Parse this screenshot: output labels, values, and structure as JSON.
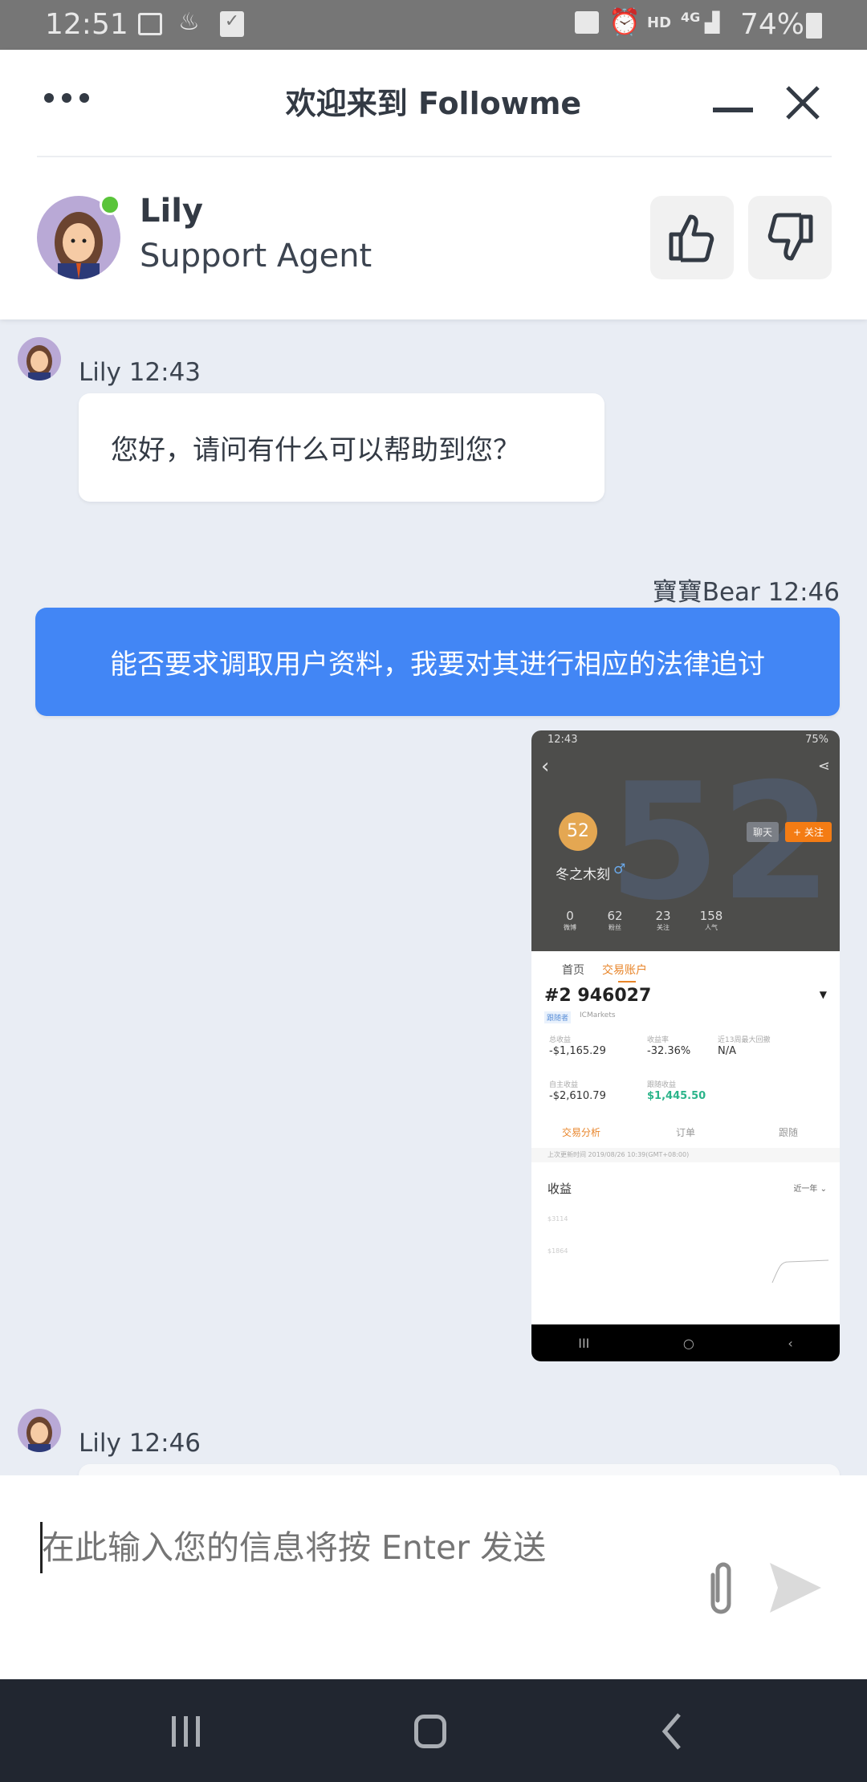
{
  "status_bar": {
    "time": "12:51",
    "battery": "74%",
    "network": "4G",
    "hd": "HD"
  },
  "header": {
    "title": "欢迎来到 Followme",
    "menu_icon": "more-dots-icon",
    "minimize_icon": "minimize-icon",
    "close_icon": "close-icon"
  },
  "agent": {
    "name": "Lily",
    "role": "Support Agent",
    "online": true,
    "online_color": "#5ac43a",
    "thumbs_up_icon": "thumbs-up-icon",
    "thumbs_down_icon": "thumbs-down-icon"
  },
  "messages": [
    {
      "sender": "Lily",
      "time": "Lily 12:43",
      "text": "您好，请问有什么可以帮助到您？"
    },
    {
      "sender": "寶寶Bear",
      "time": "寶寶Bear 12:46",
      "text": "能否要求调取用户资料，我要对其进行相应的法律追讨",
      "color": "#4286f5"
    },
    {
      "sender": "寶寶Bear",
      "type": "image"
    },
    {
      "sender": "Lily",
      "time": "Lily 12:46",
      "text": ""
    }
  ],
  "shared_image": {
    "status_time": "12:43",
    "status_battery": "75%",
    "level": "52",
    "username": "冬之木刻",
    "gender": "♂",
    "chat_btn": "聊天",
    "follow_btn": "+ 关注",
    "stats": [
      {
        "v": "0",
        "l": "微博"
      },
      {
        "v": "62",
        "l": "粉丝"
      },
      {
        "v": "23",
        "l": "关注"
      },
      {
        "v": "158",
        "l": "人气"
      }
    ],
    "tabs": [
      "首页",
      "交易账户"
    ],
    "account": "#2 946027",
    "tag1": "跟随者",
    "tag2": "ICMarkets",
    "metrics": [
      {
        "l": "总收益",
        "v": "-$1,165.29"
      },
      {
        "l": "收益率",
        "v": "-32.36%"
      },
      {
        "l": "近13周最大回撤",
        "v": "N/A"
      },
      {
        "l": "自主收益",
        "v": "-$2,610.79"
      },
      {
        "l": "跟随收益",
        "v": "$1,445.50"
      }
    ],
    "subtabs": [
      "交易分析",
      "订单",
      "跟随"
    ],
    "updated": "上次更新时间 2019/08/26 10:39(GMT+08:00)",
    "chart_title": "收益",
    "range": "近一年 ⌄",
    "y_ticks": [
      "$3114",
      "$1864"
    ]
  },
  "input": {
    "placeholder": "在此输入您的信息将按 Enter 发送",
    "attach_icon": "paperclip-icon",
    "send_icon": "send-icon"
  }
}
